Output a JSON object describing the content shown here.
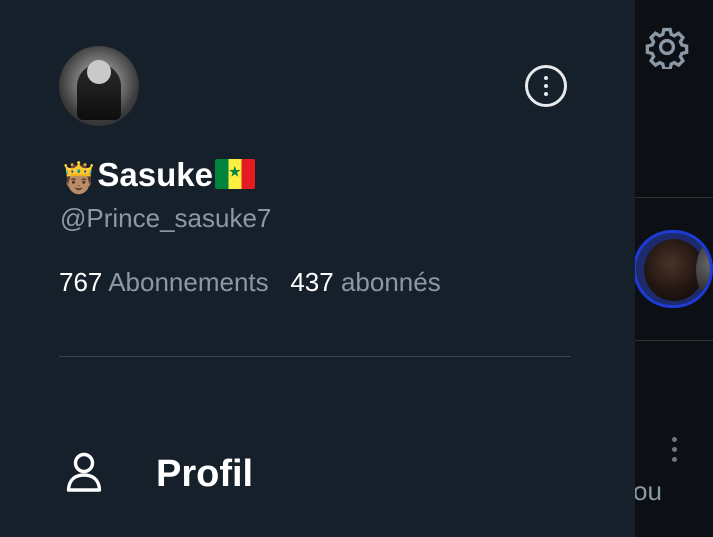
{
  "profile": {
    "display_name": "Sasuke",
    "crown_emoji": "🤴🏽",
    "flag_name": "senegal-flag",
    "handle": "@Prince_sasuke7",
    "following_count": "767",
    "following_label": "Abonnements",
    "followers_count": "437",
    "followers_label": "abonnés"
  },
  "menu": {
    "items": [
      {
        "label": "Profil",
        "icon": "person-icon"
      }
    ]
  },
  "background": {
    "partial_text": "ou"
  },
  "colors": {
    "drawer_bg": "#15202b",
    "secondary_text": "#8b98a5",
    "primary_text": "#ffffff"
  }
}
